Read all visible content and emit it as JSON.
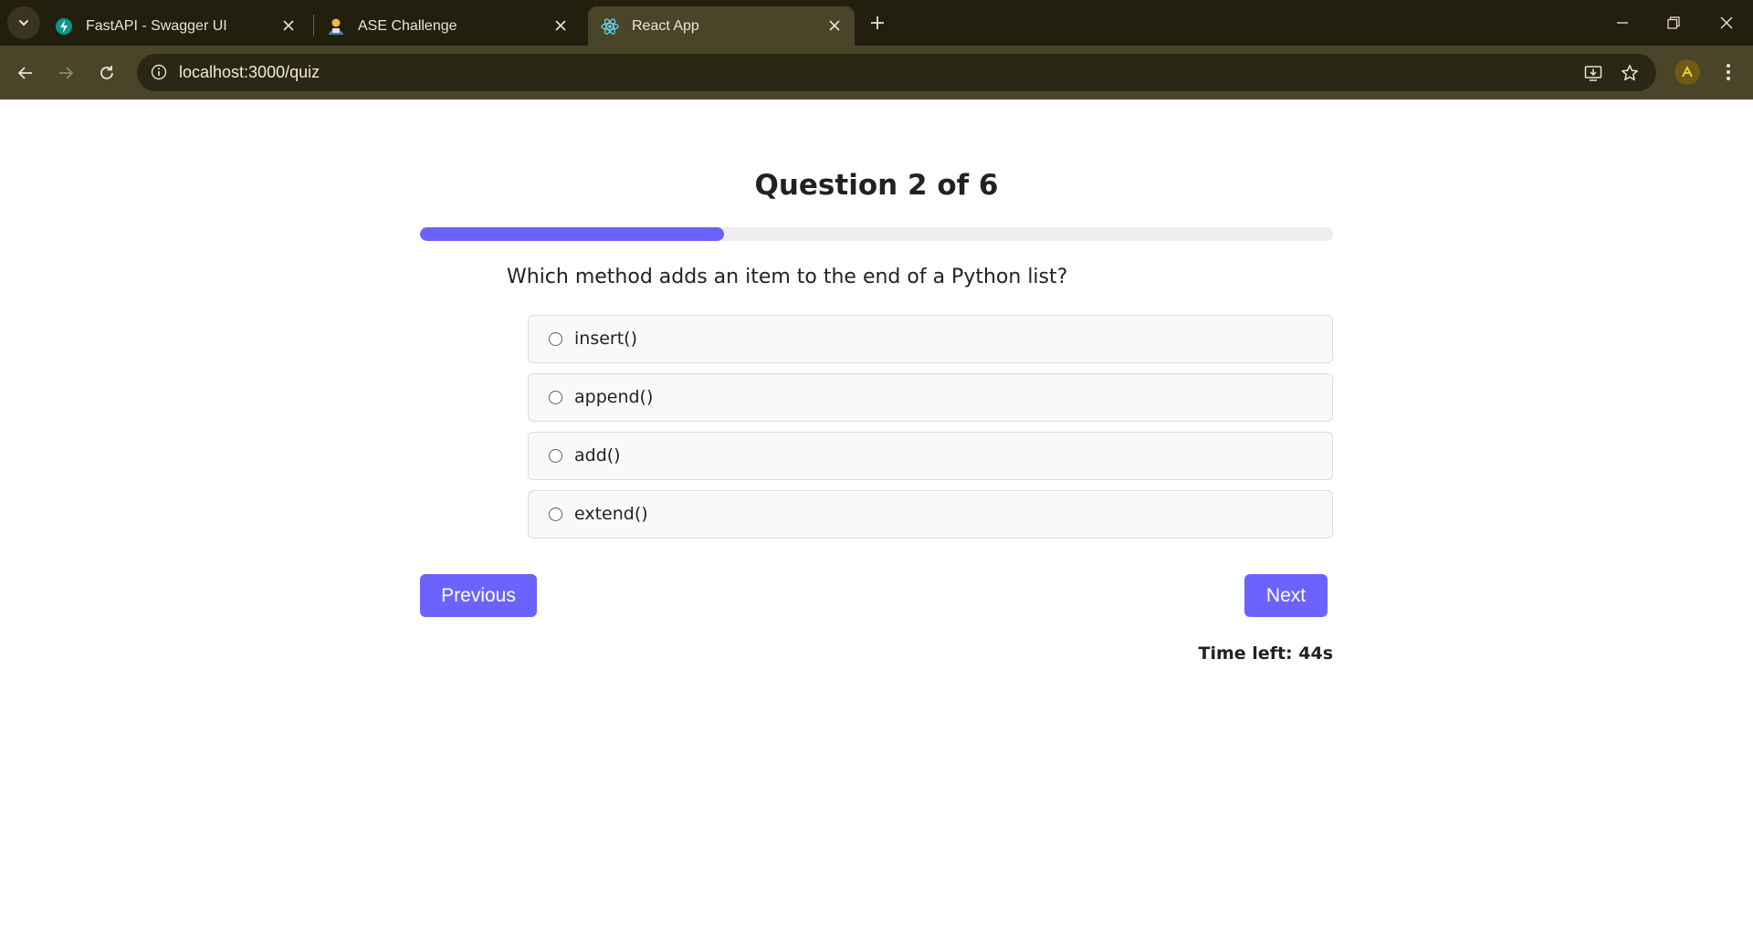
{
  "browser": {
    "tabs": [
      {
        "title": "FastAPI - Swagger UI",
        "favicon": "fastapi-icon"
      },
      {
        "title": "ASE Challenge",
        "favicon": "person-icon"
      },
      {
        "title": "React App",
        "favicon": "react-icon",
        "active": true
      }
    ],
    "url": "localhost:3000/quiz"
  },
  "quiz": {
    "title": "Question 2 of 6",
    "progress_fraction": 0.333,
    "question": "Which method adds an item to the end of a Python list?",
    "options": [
      "insert()",
      "append()",
      "add()",
      "extend()"
    ],
    "prev_label": "Previous",
    "next_label": "Next",
    "timer": "Time left: 44s"
  },
  "colors": {
    "accent": "#6c63ff",
    "chrome_dark": "#231f0f",
    "chrome_toolbar": "#4a4429"
  }
}
